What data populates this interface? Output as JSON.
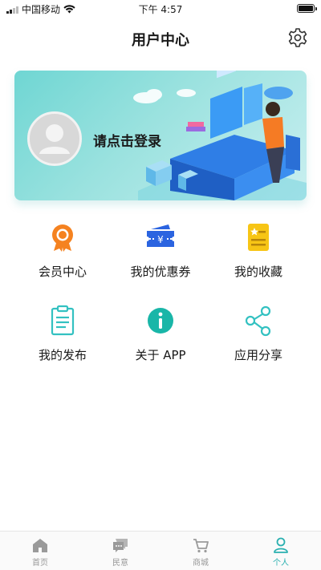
{
  "status_bar": {
    "carrier": "中国移动",
    "time": "下午 4:57"
  },
  "header": {
    "title": "用户中心",
    "settings_icon": "gear-icon"
  },
  "banner": {
    "login_text": "请点击登录",
    "avatar_icon": "user-avatar-icon"
  },
  "grid": {
    "items": [
      {
        "label": "会员中心",
        "icon": "medal-icon",
        "color": "#f58220"
      },
      {
        "label": "我的优惠券",
        "icon": "coupon-icon",
        "color": "#2b64e0"
      },
      {
        "label": "我的收藏",
        "icon": "bookmark-note-icon",
        "color": "#f7c515"
      },
      {
        "label": "我的发布",
        "icon": "clipboard-icon",
        "color": "#33c1c1"
      },
      {
        "label": "关于 APP",
        "icon": "info-icon",
        "color": "#19b6a8"
      },
      {
        "label": "应用分享",
        "icon": "share-icon",
        "color": "#33c1c1"
      }
    ]
  },
  "tabbar": {
    "tabs": [
      {
        "label": "首页",
        "icon": "home-icon",
        "active": false
      },
      {
        "label": "民意",
        "icon": "chat-icon",
        "active": false
      },
      {
        "label": "商城",
        "icon": "cart-icon",
        "active": false
      },
      {
        "label": "个人",
        "icon": "person-icon",
        "active": true
      }
    ],
    "colors": {
      "active": "#2ab0b0",
      "inactive": "#999999"
    }
  }
}
